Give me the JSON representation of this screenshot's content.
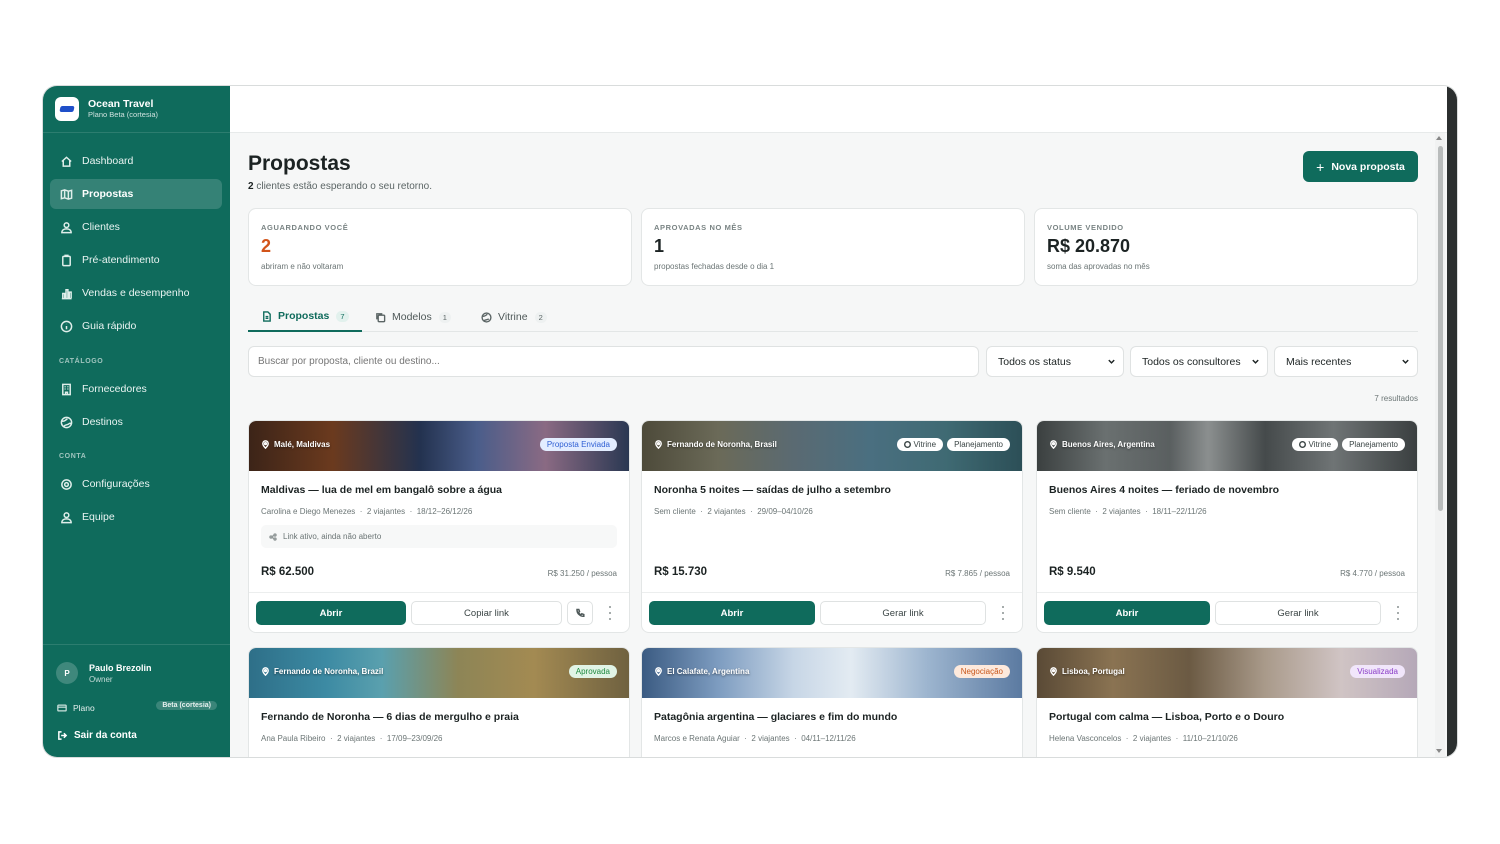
{
  "brand": {
    "name": "Ocean Travel",
    "plan": "Plano Beta (cortesia)"
  },
  "sidebar": {
    "items": [
      {
        "label": "Dashboard"
      },
      {
        "label": "Propostas"
      },
      {
        "label": "Clientes"
      },
      {
        "label": "Pré-atendimento"
      },
      {
        "label": "Vendas e desempenho"
      },
      {
        "label": "Guia rápido"
      }
    ],
    "catalog_label": "CATÁLOGO",
    "catalog_items": [
      {
        "label": "Fornecedores"
      },
      {
        "label": "Destinos"
      }
    ],
    "account_label": "CONTA",
    "account_items": [
      {
        "label": "Configurações"
      },
      {
        "label": "Equipe"
      }
    ],
    "user": {
      "initial": "P",
      "name": "Paulo Brezolin",
      "role": "Owner"
    },
    "plan_label": "Plano",
    "plan_badge": "Beta (cortesia)",
    "logout": "Sair da conta"
  },
  "header": {
    "title": "Propostas",
    "subtitle_count": "2",
    "subtitle_rest": " clientes estão esperando o seu retorno.",
    "new_button": "Nova proposta"
  },
  "stats": [
    {
      "label": "AGUARDANDO VOCÊ",
      "value": "2",
      "note": "abriram e não voltaram"
    },
    {
      "label": "APROVADAS NO MÊS",
      "value": "1",
      "note": "propostas fechadas desde o dia 1"
    },
    {
      "label": "VOLUME VENDIDO",
      "value": "R$ 20.870",
      "note": "soma das aprovadas no mês"
    }
  ],
  "tabs": [
    {
      "label": "Propostas",
      "count": "7"
    },
    {
      "label": "Modelos",
      "count": "1"
    },
    {
      "label": "Vitrine",
      "count": "2"
    }
  ],
  "filters": {
    "search_placeholder": "Buscar por proposta, cliente ou destino...",
    "status": "Todos os status",
    "consultants": "Todos os consultores",
    "sort": "Mais recentes",
    "results": "7 resultados"
  },
  "cards": [
    {
      "location": "Malé, Maldivas",
      "badges": [
        "Proposta Enviada"
      ],
      "title": "Maldivas — lua de mel em bangalô sobre a água",
      "client": "Carolina e Diego Menezes",
      "travelers": "2 viajantes",
      "dates": "18/12–26/12/26",
      "link_status": "Link ativo, ainda não aberto",
      "price": "R$ 62.500",
      "per_person": "R$ 31.250 / pessoa",
      "open": "Abrir",
      "secondary": "Copiar link"
    },
    {
      "location": "Fernando de Noronha, Brasil",
      "badges": [
        "Vitrine",
        "Planejamento"
      ],
      "title": "Noronha 5 noites — saídas de julho a setembro",
      "client": "Sem cliente",
      "travelers": "2 viajantes",
      "dates": "29/09–04/10/26",
      "price": "R$ 15.730",
      "per_person": "R$ 7.865 / pessoa",
      "open": "Abrir",
      "secondary": "Gerar link"
    },
    {
      "location": "Buenos Aires, Argentina",
      "badges": [
        "Vitrine",
        "Planejamento"
      ],
      "title": "Buenos Aires 4 noites — feriado de novembro",
      "client": "Sem cliente",
      "travelers": "2 viajantes",
      "dates": "18/11–22/11/26",
      "price": "R$ 9.540",
      "per_person": "R$ 4.770 / pessoa",
      "open": "Abrir",
      "secondary": "Gerar link"
    },
    {
      "location": "Fernando de Noronha, Brazil",
      "badges": [
        "Aprovada"
      ],
      "title": "Fernando de Noronha — 6 dias de mergulho e praia",
      "client": "Ana Paula Ribeiro",
      "travelers": "2 viajantes",
      "dates": "17/09–23/09/26"
    },
    {
      "location": "El Calafate, Argentina",
      "badges": [
        "Negociação"
      ],
      "title": "Patagônia argentina — glaciares e fim do mundo",
      "client": "Marcos e Renata Aguiar",
      "travelers": "2 viajantes",
      "dates": "04/11–12/11/26"
    },
    {
      "location": "Lisboa, Portugal",
      "badges": [
        "Visualizada"
      ],
      "title": "Portugal com calma — Lisboa, Porto e o Douro",
      "client": "Helena Vasconcelos",
      "travelers": "2 viajantes",
      "dates": "11/10–21/10/26"
    }
  ],
  "meta_separator": "·",
  "colors": {
    "primary": "#0f6b5c",
    "attention": "#d2541a"
  }
}
